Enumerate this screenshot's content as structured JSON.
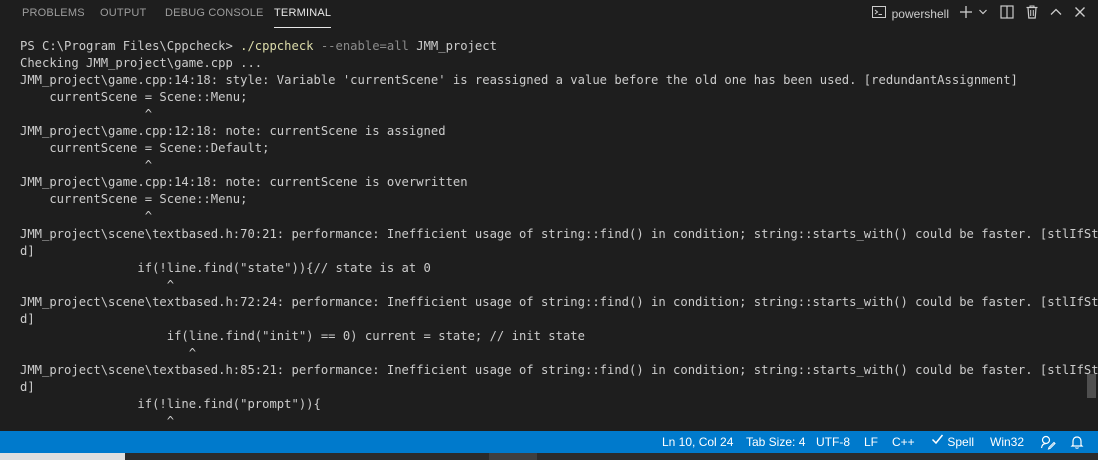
{
  "tabs": {
    "problems": "PROBLEMS",
    "output": "OUTPUT",
    "debug_console": "DEBUG CONSOLE",
    "terminal": "TERMINAL"
  },
  "terminal_actions": {
    "shell_name": "powershell",
    "icons": [
      "terminal-icon",
      "plus-icon",
      "chevron-down-icon",
      "split-icon",
      "trash-icon",
      "chevron-up-icon",
      "close-icon"
    ]
  },
  "terminal": {
    "prompt": "PS C:\\Program Files\\Cppcheck> ",
    "command": "./cppcheck",
    "option": " --enable=all",
    "argument": " JMM_project",
    "lines": [
      "Checking JMM_project\\game.cpp ...",
      "JMM_project\\game.cpp:14:18: style: Variable 'currentScene' is reassigned a value before the old one has been used. [redundantAssignment]",
      "    currentScene = Scene::Menu;",
      "                 ^",
      "JMM_project\\game.cpp:12:18: note: currentScene is assigned",
      "    currentScene = Scene::Default;",
      "                 ^",
      "JMM_project\\game.cpp:14:18: note: currentScene is overwritten",
      "    currentScene = Scene::Menu;",
      "                 ^",
      "JMM_project\\scene\\textbased.h:70:21: performance: Inefficient usage of string::find() in condition; string::starts_with() could be faster. [stlIfStrFin",
      "d]",
      "                if(!line.find(\"state\")){// state is at 0",
      "                    ^",
      "JMM_project\\scene\\textbased.h:72:24: performance: Inefficient usage of string::find() in condition; string::starts_with() could be faster. [stlIfStrFin",
      "d]",
      "                    if(line.find(\"init\") == 0) current = state; // init state",
      "                       ^",
      "JMM_project\\scene\\textbased.h:85:21: performance: Inefficient usage of string::find() in condition; string::starts_with() could be faster. [stlIfStrFin",
      "d]",
      "                if(!line.find(\"prompt\")){",
      "                    ^"
    ]
  },
  "statusbar": {
    "position": "Ln 10, Col 24",
    "tab_size": "Tab Size: 4",
    "encoding": "UTF-8",
    "eol": "LF",
    "language": "C++",
    "spell": "Spell",
    "platform": "Win32"
  },
  "colors": {
    "statusbar": "#007acc",
    "background": "#1e1e1e",
    "command": "#dcdcaa"
  }
}
